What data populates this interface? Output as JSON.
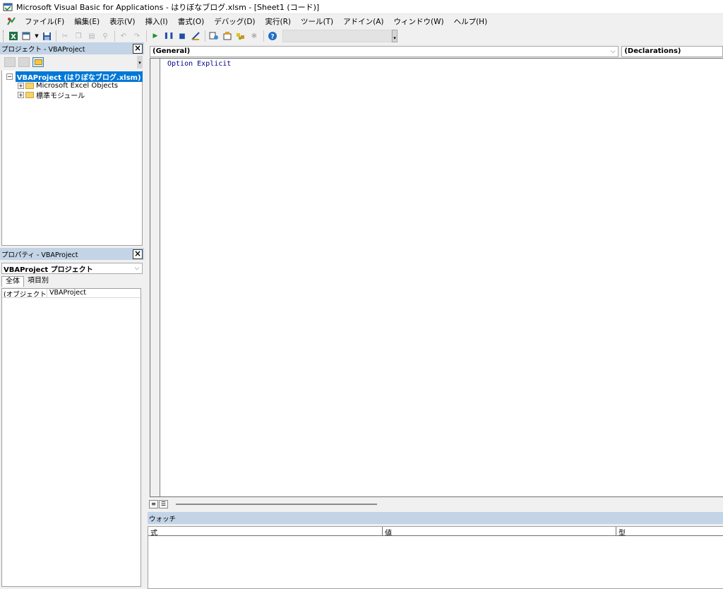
{
  "window": {
    "title": "Microsoft Visual Basic for Applications - はりぼなブログ.xlsm - [Sheet1 (コード)]"
  },
  "menu": [
    "ファイル(F)",
    "編集(E)",
    "表示(V)",
    "挿入(I)",
    "書式(O)",
    "デバッグ(D)",
    "実行(R)",
    "ツール(T)",
    "アドイン(A)",
    "ウィンドウ(W)",
    "ヘルプ(H)"
  ],
  "toolbar": {
    "icons": [
      "view-excel-icon",
      "insert-module-icon",
      "save-icon",
      "cut-icon",
      "copy-icon",
      "paste-icon",
      "find-icon",
      "undo-icon",
      "redo-icon",
      "run-icon",
      "break-icon",
      "reset-icon",
      "design-mode-icon",
      "project-explorer-icon",
      "properties-icon",
      "object-browser-icon",
      "toolbox-icon",
      "help-icon"
    ]
  },
  "project_panel": {
    "title": "プロジェクト - VBAProject",
    "tree": {
      "root": "VBAProject (はりぼなブログ.xlsm)",
      "children": [
        "Microsoft Excel Objects",
        "標準モジュール"
      ]
    }
  },
  "properties_panel": {
    "title": "プロパティ - VBAProject",
    "object_combo": "VBAProject プロジェクト",
    "tabs": [
      "全体",
      "項目別"
    ],
    "rows": [
      {
        "key": "(オブジェクト名)",
        "value": "VBAProject"
      }
    ]
  },
  "code_window": {
    "object_combo": "(General)",
    "procedure_combo": "(Declarations)",
    "lines": [
      "Option Explicit"
    ]
  },
  "watch_window": {
    "title": "ウォッチ",
    "columns": [
      "式",
      "値",
      "型"
    ]
  },
  "colors": {
    "panel_title_bg": "#c2d4e6",
    "selection": "#0078d7",
    "code_keyword": "#00008b"
  }
}
